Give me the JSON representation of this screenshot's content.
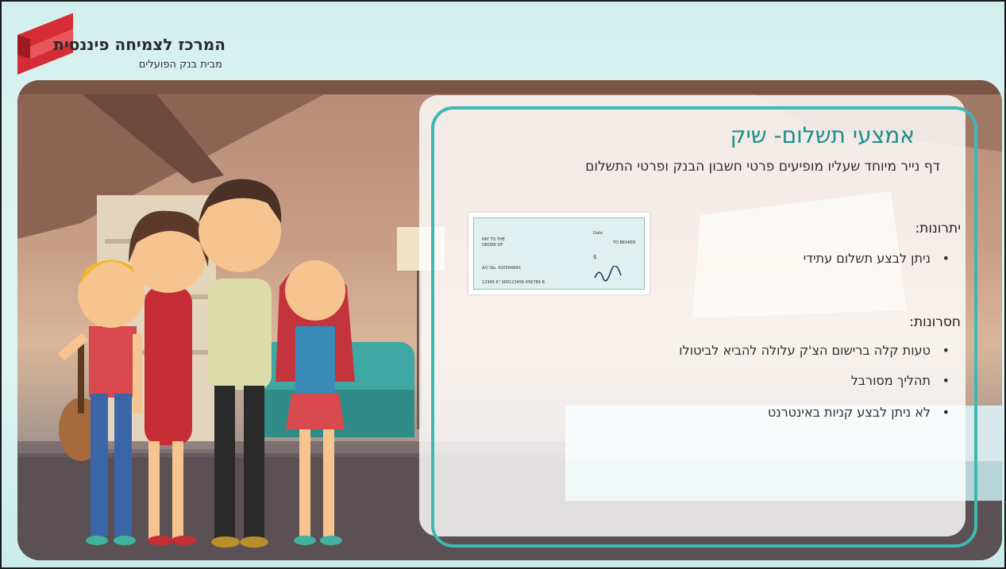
{
  "logo": {
    "title": "המרכז לצמיחה פיננסית",
    "subtitle": "מבית בנק הפועלים"
  },
  "slide": {
    "title": "אמצעי תשלום- שיק",
    "subtitle": "דף נייר מיוחד שעליו מופיעים פרטי חשבון הבנק ופרטי התשלום",
    "advantages": {
      "heading": "יתרונות:",
      "items": [
        "ניתן לבצע תשלום עתידי"
      ]
    },
    "disadvantages": {
      "heading": "חסרונות:",
      "items": [
        "טעות קלה ברישום הצ'ק עלולה להביא לביטולו",
        "תהליך מסורבל",
        "לא ניתן לבצע קניות באינטרנט"
      ]
    }
  },
  "check_image": {
    "date_label": "Date",
    "pay_to_label": "PAY TO THE",
    "order_label": "ORDER OF",
    "bearer_label": "TO BEARER",
    "currency": "$",
    "account_label": "A/C No.",
    "account_number": "42058489X",
    "micr_line": "12345 6\" 000123456 456789 B"
  },
  "colors": {
    "accent": "#1b8e88",
    "border": "#3fb8b2",
    "logo_red": "#d42d35"
  }
}
